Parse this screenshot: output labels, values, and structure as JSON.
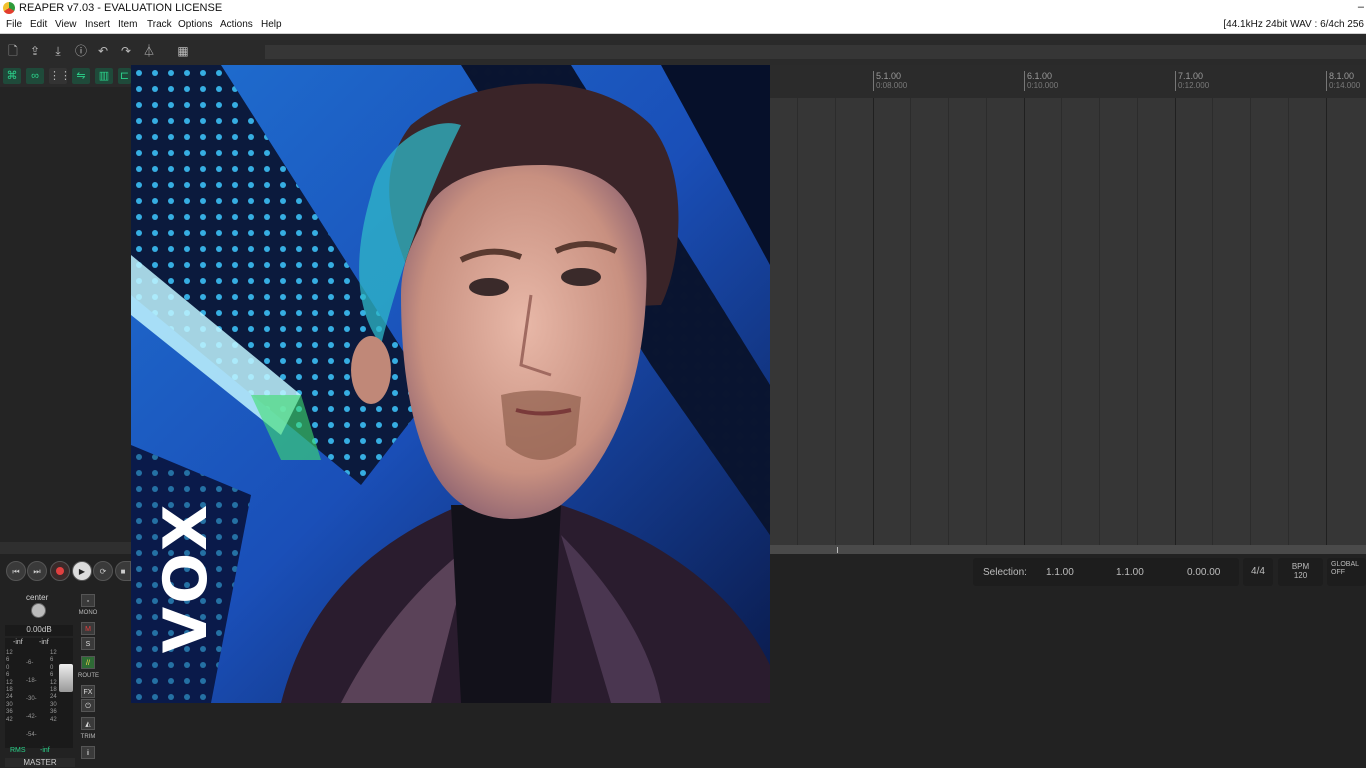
{
  "window": {
    "title": "REAPER v7.03 - EVALUATION LICENSE",
    "close": "–"
  },
  "menu": {
    "items": [
      "File",
      "Edit",
      "View",
      "Insert",
      "Item",
      "Track",
      "Options",
      "Actions",
      "Help"
    ],
    "format": "[44.1kHz 24bit WAV : 6/4ch 256"
  },
  "toolbar": {
    "icons": [
      "new-project-icon",
      "open-project-icon",
      "save-project-icon",
      "project-settings-icon",
      "undo-icon",
      "redo-icon",
      "metronome-icon",
      "grid-icon"
    ]
  },
  "ruler": {
    "marks": [
      {
        "bar": "5.1.00",
        "time": "0:08.000"
      },
      {
        "bar": "6.1.00",
        "time": "0:10.000"
      },
      {
        "bar": "7.1.00",
        "time": "0:12.000"
      },
      {
        "bar": "8.1.00",
        "time": "0:14.000"
      }
    ]
  },
  "selection": {
    "label": "Selection:",
    "start": "1.1.00",
    "end": "1.1.00",
    "length": "0.00.00"
  },
  "time_signature": "4/4",
  "bpm": {
    "label": "BPM",
    "value": "120"
  },
  "global": {
    "label": "GLOBAL",
    "state": "OFF"
  },
  "master": {
    "pan": "center",
    "volume": "0.00dB",
    "peak_left": "-inf",
    "peak_right": "-inf",
    "rms_label": "RMS",
    "rms_value": "-inf",
    "label": "MASTER",
    "mono": "MONO",
    "mute": "M",
    "solo": "S",
    "route": "ROUTE",
    "fx": "FX",
    "trim": "TRIM",
    "info": "i",
    "scale_left": [
      "12",
      "6",
      "0",
      "6",
      "12",
      "18",
      "24",
      "30",
      "36",
      "42"
    ],
    "scale_mid": [
      "-6-",
      "-18-",
      "-30-",
      "-42-",
      "-54-"
    ],
    "scale_right": [
      "12",
      "6",
      "0",
      "6",
      "12",
      "18",
      "24",
      "30",
      "36",
      "42"
    ]
  },
  "overlay": {
    "text": "VOX"
  }
}
